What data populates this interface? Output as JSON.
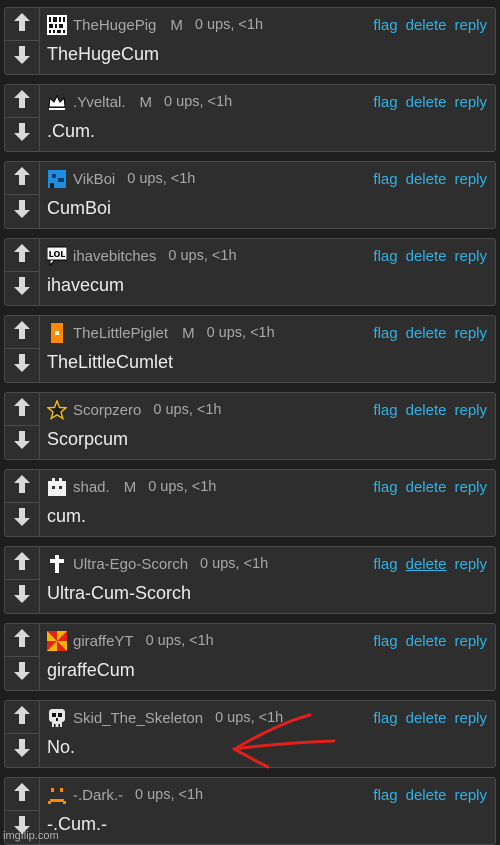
{
  "labels": {
    "flag": "flag",
    "delete": "delete",
    "reply": "reply"
  },
  "comments": [
    {
      "username": "TheHugePig",
      "mod": "M",
      "ups": "0 ups, <1h",
      "text": "TheHugeCum",
      "avatar": "binary-pixel-icon"
    },
    {
      "username": ".Yveltal.",
      "mod": "M",
      "ups": "0 ups, <1h",
      "text": ".Cum.",
      "avatar": "crown-icon"
    },
    {
      "username": "VikBoi",
      "mod": "",
      "ups": "0 ups, <1h",
      "text": "CumBoi",
      "avatar": "blue-pixel-creature-icon"
    },
    {
      "username": "ihavebitches",
      "mod": "",
      "ups": "0 ups, <1h",
      "text": "ihavecum",
      "avatar": "lol-speech-bubble-icon"
    },
    {
      "username": "TheLittlePiglet",
      "mod": "M",
      "ups": "0 ups, <1h",
      "text": "TheLittleCumlet",
      "avatar": "orange-block-icon"
    },
    {
      "username": "Scorpzero",
      "mod": "",
      "ups": "0 ups, <1h",
      "text": "Scorpcum",
      "avatar": "star-icon"
    },
    {
      "username": "shad.",
      "mod": "M",
      "ups": "0 ups, <1h",
      "text": "cum.",
      "avatar": "robot-face-icon"
    },
    {
      "username": "Ultra-Ego-Scorch",
      "mod": "",
      "ups": "0 ups, <1h",
      "text": "Ultra-Cum-Scorch",
      "avatar": "cross-icon"
    },
    {
      "username": "giraffeYT",
      "mod": "",
      "ups": "0 ups, <1h",
      "text": "giraffeCum",
      "avatar": "pinwheel-icon"
    },
    {
      "username": "Skid_The_Skeleton",
      "mod": "",
      "ups": "0 ups, <1h",
      "text": "No.",
      "avatar": "skull-icon"
    },
    {
      "username": "-.Dark.-",
      "mod": "",
      "ups": "0 ups, <1h",
      "text": "-.Cum.-",
      "avatar": "sad-face-icon"
    }
  ],
  "underlined_delete_index": 7,
  "annotation": {
    "color": "#e0201b",
    "target_index": 9,
    "icon": "red-arrow-icon"
  },
  "watermark": "imgflip.com",
  "colors": {
    "link": "#2fb3e6",
    "meta": "#a8a8a8",
    "body": "#ececec",
    "panel": "#2e2e2e"
  }
}
